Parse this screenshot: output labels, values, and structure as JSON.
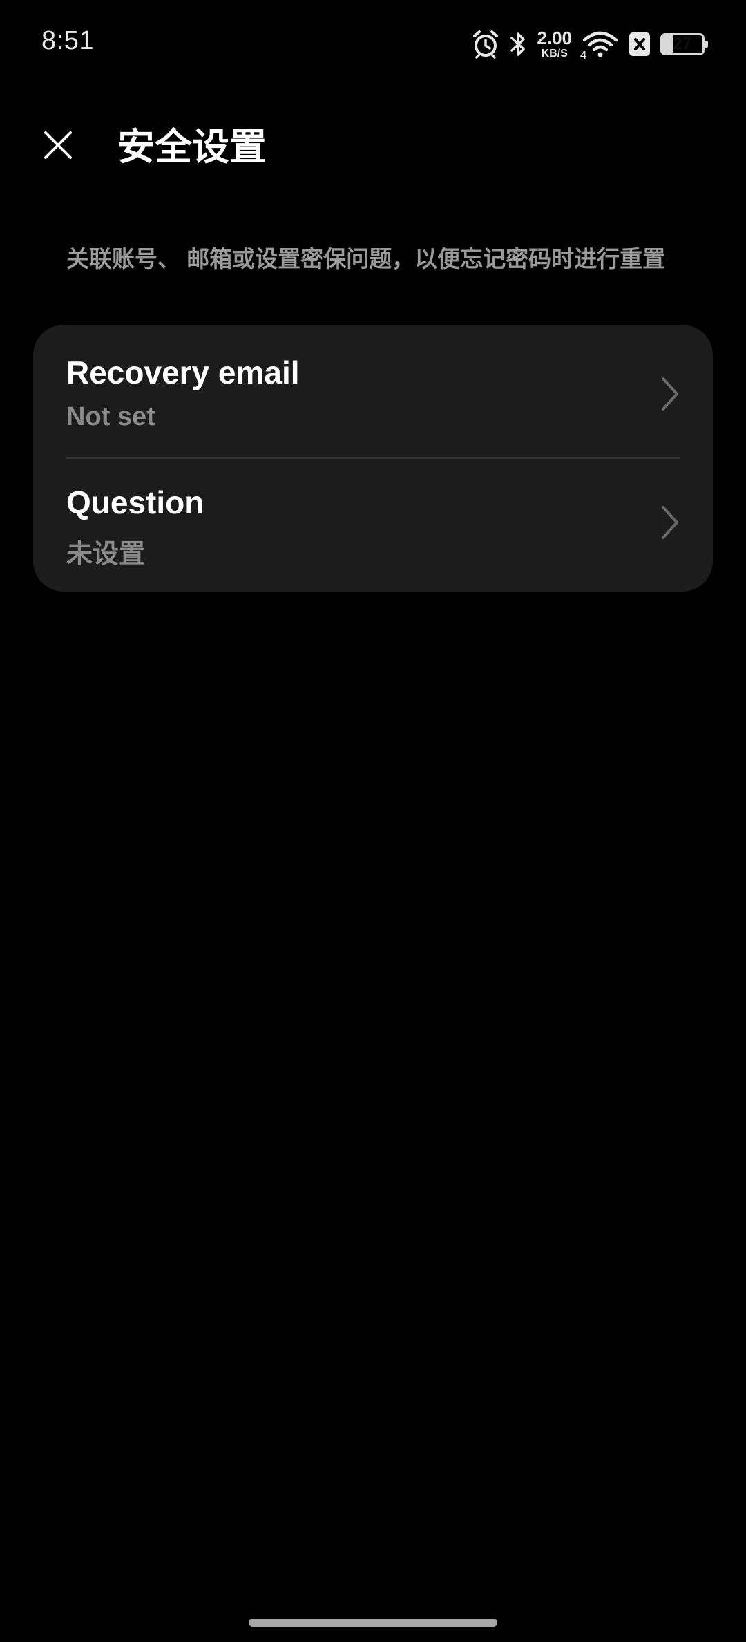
{
  "status_bar": {
    "time": "8:51",
    "net_speed_value": "2.00",
    "net_speed_unit": "KB/S",
    "network_type": "4",
    "battery_level": "27",
    "icons": [
      "alarm-icon",
      "bluetooth-icon",
      "wifi-icon",
      "no-sim-icon",
      "battery-icon"
    ]
  },
  "header": {
    "title": "安全设置",
    "close_icon": "close-icon"
  },
  "description": "关联账号、 邮箱或设置密保问题，以便忘记密码时进行重置",
  "settings": {
    "items": [
      {
        "title": "Recovery email",
        "value": "Not set",
        "icon": "chevron-right-icon"
      },
      {
        "title": "Question",
        "value": "未设置",
        "icon": "chevron-right-icon"
      }
    ]
  },
  "colors": {
    "background": "#000000",
    "card": "#1c1c1c",
    "primary_text": "#ffffff",
    "secondary_text": "#8a8a8a",
    "divider": "#333333"
  }
}
